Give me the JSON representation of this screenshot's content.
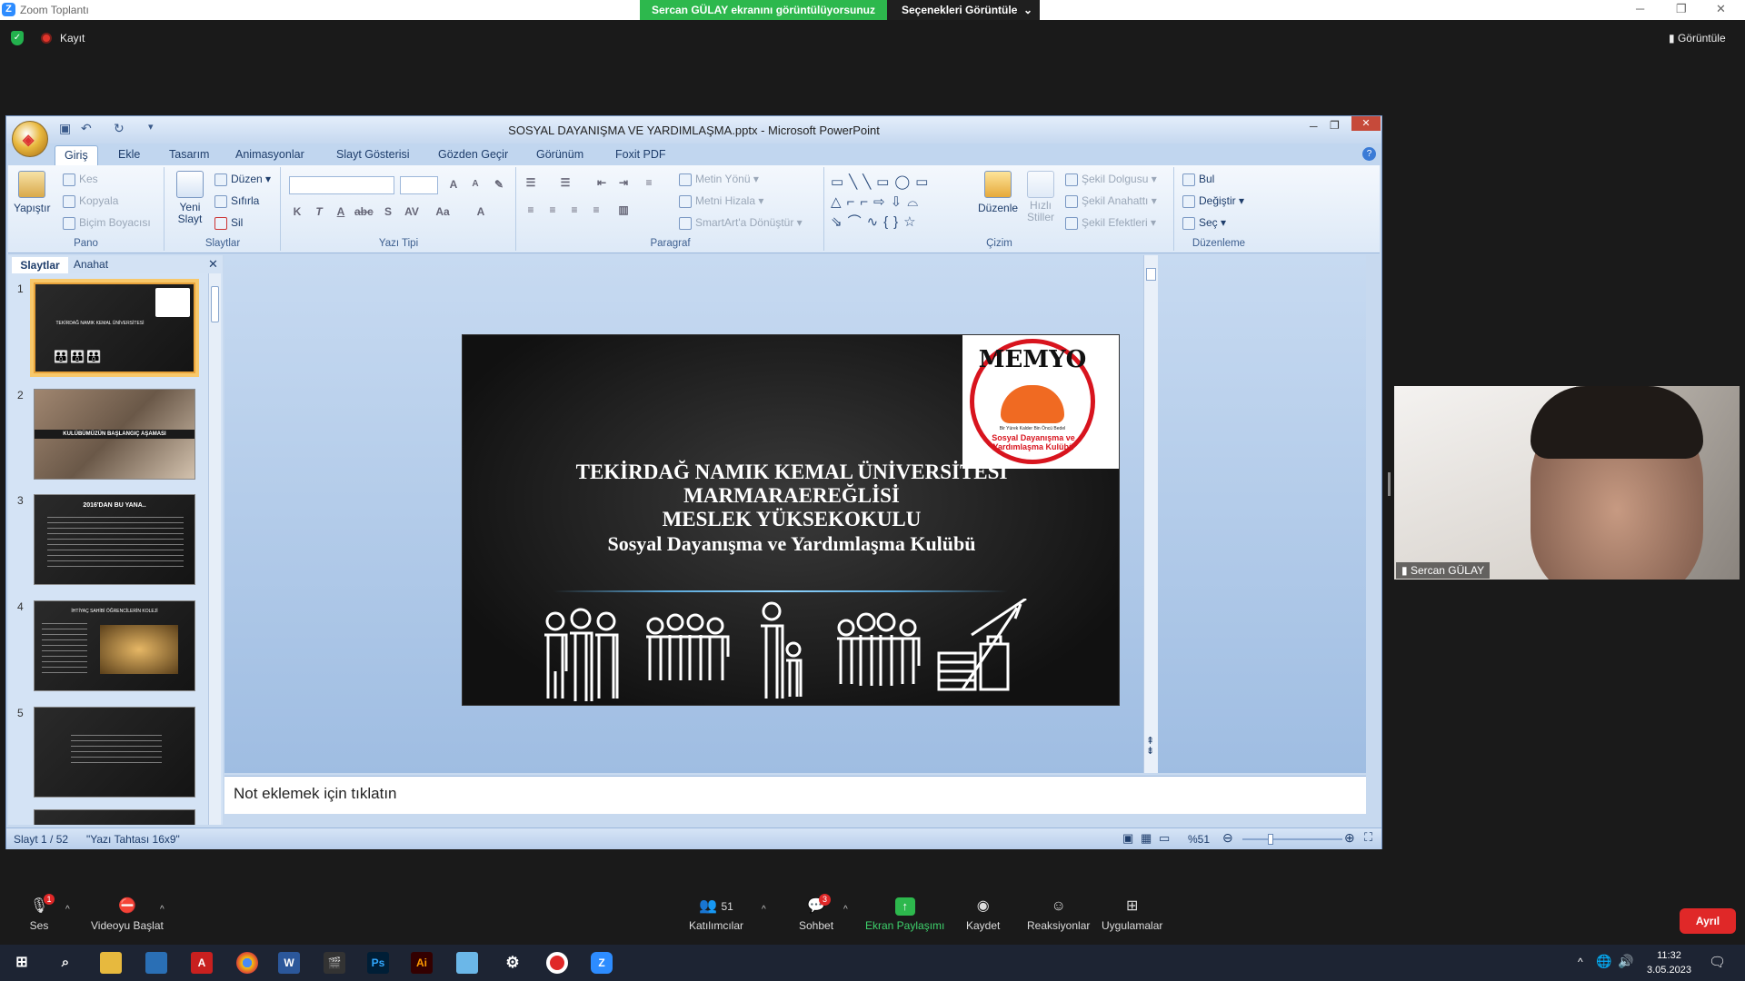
{
  "zoom": {
    "window_title": "Zoom Toplantı",
    "share_banner": "Sercan GÜLAY ekranını görüntülüyorsunuz",
    "view_options": "Seçenekleri Görüntüle",
    "recording_label": "Kayıt",
    "view_button": "Görüntüle",
    "leave_button": "Ayrıl",
    "toolbar": {
      "audio": "Ses",
      "audio_badge": "1",
      "video": "Videoyu Başlat",
      "participants": "Katılımcılar",
      "participants_count": "51",
      "chat": "Sohbet",
      "chat_badge": "3",
      "share": "Ekran Paylaşımı",
      "record": "Kaydet",
      "reactions": "Reaksiyonlar",
      "apps": "Uygulamalar"
    },
    "participant_name": "Sercan GÜLAY"
  },
  "ppt": {
    "title": "SOSYAL DAYANIŞMA VE YARDIMLAŞMA.pptx - Microsoft PowerPoint",
    "tabs": [
      "Giriş",
      "Ekle",
      "Tasarım",
      "Animasyonlar",
      "Slayt Gösterisi",
      "Gözden Geçir",
      "Görünüm",
      "Foxit PDF"
    ],
    "ribbon": {
      "pano": {
        "label": "Pano",
        "paste": "Yapıştır",
        "cut": "Kes",
        "copy": "Kopyala",
        "format_painter": "Biçim Boyacısı"
      },
      "slaytlar": {
        "label": "Slaytlar",
        "new_slide": "Yeni Slayt",
        "layout": "Düzen",
        "reset": "Sıfırla",
        "delete": "Sil"
      },
      "yazi_tipi": {
        "label": "Yazı Tipi"
      },
      "paragraf": {
        "label": "Paragraf",
        "text_direction": "Metin Yönü",
        "align_text": "Metni Hizala",
        "smartart": "SmartArt'a Dönüştür"
      },
      "cizim": {
        "label": "Çizim",
        "arrange": "Düzenle",
        "quick_styles": "Hızlı Stiller",
        "shape_fill": "Şekil Dolgusu",
        "shape_outline": "Şekil Anahattı",
        "shape_effects": "Şekil Efektleri"
      },
      "duzenleme": {
        "label": "Düzenleme",
        "find": "Bul",
        "replace": "Değiştir",
        "select": "Seç"
      }
    },
    "panel_tabs": {
      "slides": "Slaytlar",
      "outline": "Anahat"
    },
    "slide_numbers": [
      "1",
      "2",
      "3",
      "4",
      "5"
    ],
    "thumb_texts": {
      "t1": "TEKİRDAĞ NAMIK KEMAL ÜNİVERSİTESİ",
      "t2": "KULÜBÜMÜZÜN BAŞLANGIÇ AŞAMASI",
      "t3": "2016'DAN BU YANA..",
      "t4": "İHTİYAÇ SAHİBİ ÖĞRENCİLERİN KOLEJİ"
    },
    "slide": {
      "logo_title": "MEMYO",
      "logo_ring_text": "Sosyal Dayanışma ve Yardımlaşma Kulübü",
      "logo_motto": "Bir Yürek Kalder Bin Öncü Bedel",
      "line1": "TEKİRDAĞ NAMIK KEMAL ÜNİVERSİTESİ",
      "line2": "MARMARAEREĞLİSİ",
      "line3": "MESLEK YÜKSEKOKULU",
      "line4": "Sosyal Dayanışma ve Yardımlaşma Kulübü"
    },
    "notes_placeholder": "Not eklemek için tıklatın",
    "status": {
      "slide_pos": "Slayt 1 / 52",
      "theme": "\"Yazı Tahtası 16x9\"",
      "zoom": "%51"
    }
  },
  "taskbar": {
    "time": "11:32",
    "date": "3.05.2023"
  },
  "colors": {
    "zoom_green": "#2db84d",
    "leave_red": "#e02828",
    "ppt_blue": "#c7d9ef"
  }
}
